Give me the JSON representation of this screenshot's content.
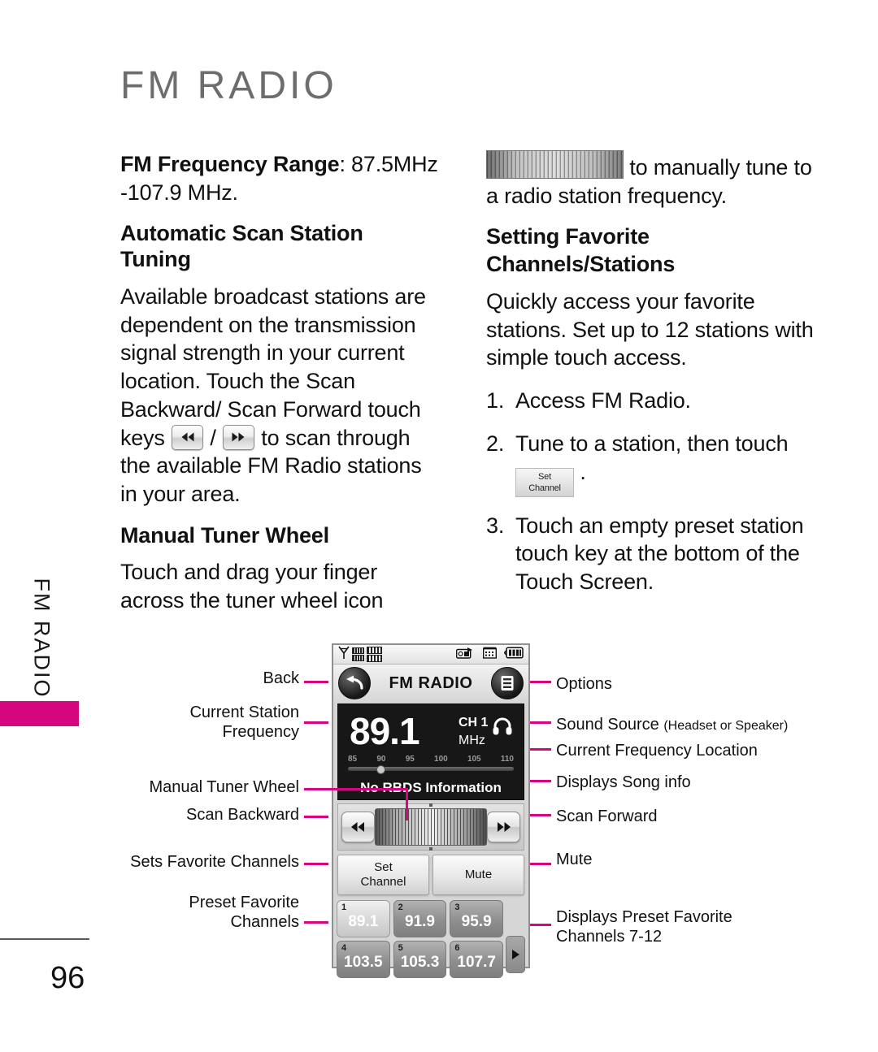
{
  "page": {
    "title": "FM RADIO",
    "side_tab_label": "FM RADIO",
    "number": "96",
    "accent_color": "#d5067e"
  },
  "left_column": {
    "freq_range_bold": "FM Frequency Range",
    "freq_range_value": ": 87.5MHz -107.9 MHz.",
    "heading_auto_scan": "Automatic Scan Station Tuning",
    "auto_scan_p1": "Available broadcast stations are dependent on the transmission signal strength in your current location. Touch the Scan Backward/ Scan Forward touch keys",
    "auto_scan_sep": "/",
    "auto_scan_p2": "to scan through the available FM Radio stations in your area.",
    "heading_manual_wheel": "Manual Tuner Wheel",
    "manual_wheel_p1": "Touch and drag your finger across the tuner wheel icon"
  },
  "right_column": {
    "wheel_sentence": "to manually tune to a radio station frequency.",
    "heading_favorites_line1": "Setting Favorite",
    "heading_favorites_line2": "Channels/Stations",
    "favorites_p": "Quickly access your favorite stations. Set up to 12 stations with simple touch access.",
    "steps": [
      {
        "num": "1.",
        "text": "Access FM Radio."
      },
      {
        "num": "2.",
        "text_before": "Tune to a station, then touch",
        "button_line1": "Set",
        "button_line2": "Channel",
        "text_after": "."
      },
      {
        "num": "3.",
        "text": "Touch an empty preset station touch key at the bottom of the Touch Screen."
      }
    ]
  },
  "device": {
    "status_icons": [
      "antenna-icon",
      "signal-bars-icon",
      "fm-radio-icon",
      "calendar-icon",
      "battery-icon"
    ],
    "title": "FM RADIO",
    "back_icon": "back-arrow-icon",
    "options_icon": "options-menu-icon",
    "frequency": "89.1",
    "channel_label": "CH 1",
    "unit_label": "MHz",
    "sound_source_icon": "headset-icon",
    "scale_ticks": [
      "85",
      "90",
      "95",
      "100",
      "105",
      "110"
    ],
    "rbds_text": "No RBDS Information",
    "scan_backward_icon": "scan-backward-icon",
    "scan_forward_icon": "scan-forward-icon",
    "tuner_wheel_name": "manual-tuner-wheel",
    "set_channel_line1": "Set",
    "set_channel_line2": "Channel",
    "mute_label": "Mute",
    "next_page_icon": "next-presets-arrow-icon",
    "presets": [
      {
        "idx": "1",
        "value": "89.1",
        "selected": true
      },
      {
        "idx": "2",
        "value": "91.9",
        "selected": false
      },
      {
        "idx": "3",
        "value": "95.9",
        "selected": false
      },
      {
        "idx": "4",
        "value": "103.5",
        "selected": false
      },
      {
        "idx": "5",
        "value": "105.3",
        "selected": false
      },
      {
        "idx": "6",
        "value": "107.7",
        "selected": false
      }
    ]
  },
  "callouts": {
    "left": [
      "Back",
      "Current Station Frequency",
      "Manual Tuner Wheel",
      "Scan Backward",
      "Sets Favorite Channels",
      "Preset Favorite Channels"
    ],
    "right": {
      "options": "Options",
      "sound_source": "Sound Source",
      "sound_source_sub": "(Headset or Speaker)",
      "current_freq_location": "Current Frequency Location",
      "song_info": "Displays Song info",
      "scan_forward": "Scan Forward",
      "mute": "Mute",
      "presets_7_12_line1": "Displays Preset Favorite",
      "presets_7_12_line2": "Channels 7-12"
    }
  }
}
